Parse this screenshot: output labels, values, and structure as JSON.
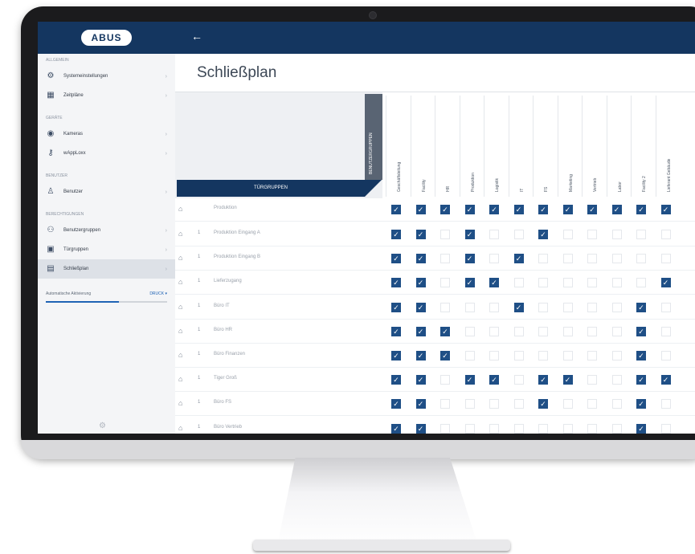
{
  "app": {
    "logo_text": "ABUS",
    "page_title": "Schließplan",
    "back_icon": "arrow-left-icon"
  },
  "sidebar": {
    "sections": [
      {
        "title": "Allgemein",
        "items": [
          {
            "label": "Systemeinstellungen",
            "icon": "gear-icon"
          },
          {
            "label": "Zeitpläne",
            "icon": "calendar-icon"
          }
        ]
      },
      {
        "title": "Geräte",
        "items": [
          {
            "label": "Kameras",
            "icon": "camera-icon"
          },
          {
            "label": "wAppLoxx",
            "icon": "key-icon"
          }
        ]
      },
      {
        "title": "Benutzer",
        "items": [
          {
            "label": "Benutzer",
            "icon": "user-icon"
          }
        ]
      },
      {
        "title": "Berechtigungen",
        "items": [
          {
            "label": "Benutzergruppen",
            "icon": "users-icon"
          },
          {
            "label": "Türgruppen",
            "icon": "door-group-icon"
          },
          {
            "label": "Schließplan",
            "icon": "lock-plan-icon",
            "active": true
          }
        ]
      }
    ],
    "auto_label": "Automatische Aktivierung",
    "auto_link": "DRUCK ▾",
    "auto_progress": 0.6
  },
  "grid": {
    "door_groups_header": "TÜRGRUPPEN",
    "user_groups_header": "BENUTZERGRUPPEN",
    "columns": [
      "Geschäftsleitung",
      "Facility",
      "HR",
      "Produktion",
      "Logistik",
      "IT",
      "FS",
      "Marketing",
      "Vertrieb",
      "Labor",
      "Facility 2",
      "Lieferant Gebäude"
    ],
    "rows": [
      {
        "num": "1",
        "name": "Produktion Eingang A",
        "checks": [
          1,
          1,
          0,
          1,
          0,
          0,
          1,
          0,
          0,
          0,
          0,
          0
        ]
      },
      {
        "num": "1",
        "name": "Produktion Eingang B",
        "checks": [
          1,
          1,
          0,
          1,
          0,
          1,
          0,
          0,
          0,
          0,
          0,
          0
        ]
      },
      {
        "num": "1",
        "name": "Lieferzugang",
        "checks": [
          1,
          1,
          0,
          1,
          1,
          0,
          0,
          0,
          0,
          0,
          0,
          1
        ]
      },
      {
        "num": "1",
        "name": "Büro IT",
        "checks": [
          1,
          1,
          0,
          0,
          0,
          1,
          0,
          0,
          0,
          0,
          1,
          0
        ]
      },
      {
        "num": "1",
        "name": "Büro HR",
        "checks": [
          1,
          1,
          1,
          0,
          0,
          0,
          0,
          0,
          0,
          0,
          1,
          0
        ]
      },
      {
        "num": "1",
        "name": "Büro Finanzen",
        "checks": [
          1,
          1,
          1,
          0,
          0,
          0,
          0,
          0,
          0,
          0,
          1,
          0
        ]
      },
      {
        "num": "1",
        "name": "Tiger Groß",
        "checks": [
          1,
          1,
          0,
          1,
          1,
          0,
          1,
          1,
          0,
          0,
          1,
          1
        ]
      },
      {
        "num": "1",
        "name": "Büro FS",
        "checks": [
          1,
          1,
          0,
          0,
          0,
          0,
          1,
          0,
          0,
          0,
          1,
          0
        ]
      },
      {
        "num": "1",
        "name": "Büro Vertrieb",
        "checks": [
          1,
          1,
          0,
          0,
          0,
          0,
          0,
          0,
          0,
          0,
          1,
          0
        ]
      }
    ],
    "top_row_checks": [
      1,
      1,
      1,
      1,
      1,
      1,
      1,
      1,
      1,
      1,
      1,
      1
    ],
    "top_row_name": "Produktion"
  },
  "colors": {
    "brand_navy": "#143660",
    "checkbox_blue": "#1f4f86",
    "sidebar_bg": "#f4f5f7"
  }
}
